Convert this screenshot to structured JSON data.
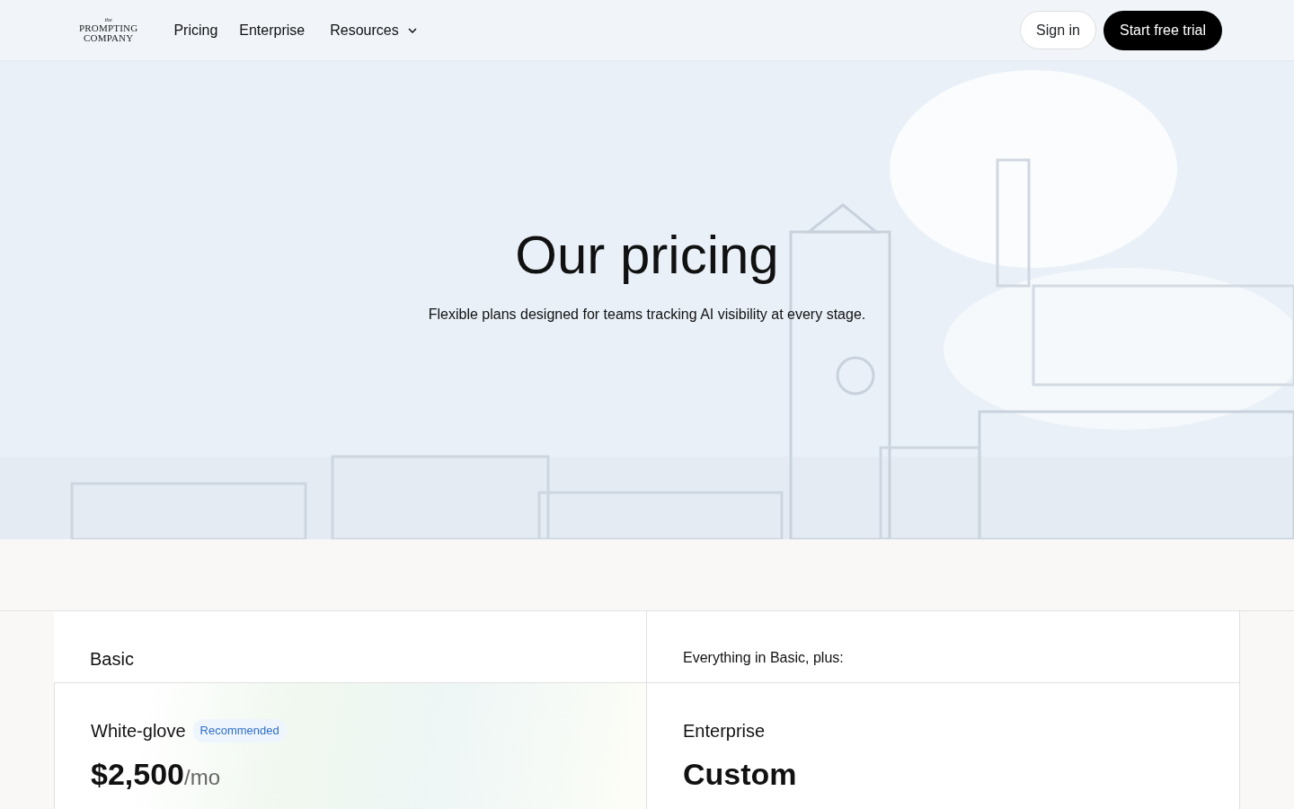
{
  "header": {
    "logo": {
      "small": "the",
      "lines": [
        "PROMPTING",
        "COMPANY"
      ]
    },
    "nav": [
      {
        "label": "Pricing",
        "dropdown": false
      },
      {
        "label": "Enterprise",
        "dropdown": false
      },
      {
        "label": "Resources",
        "dropdown": true
      }
    ],
    "actions": [
      {
        "label": "Sign in",
        "kind": "outline"
      },
      {
        "label": "Start free trial",
        "kind": "solid"
      }
    ]
  },
  "hero": {
    "title": "Our pricing",
    "subtitle": "Flexible plans designed for teams tracking AI visibility at every stage."
  },
  "plans": [
    {
      "kind": "plain",
      "name": "Basic"
    },
    {
      "kind": "features",
      "heading": "Everything in Basic, plus:"
    },
    {
      "kind": "highlight",
      "name": "White-glove",
      "badge": "Recommended",
      "price": "$2,500",
      "period": "/mo"
    },
    {
      "kind": "plain",
      "name": "Enterprise",
      "price": "Custom"
    }
  ]
}
